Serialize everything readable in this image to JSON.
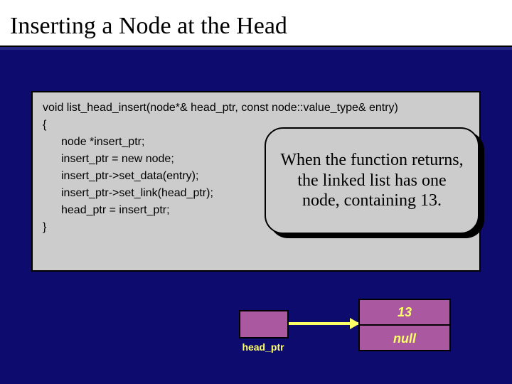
{
  "title": "Inserting a Node at the Head",
  "code": {
    "sig": "void list_head_insert(node*& head_ptr, const node::value_type& entry)",
    "open": "{",
    "l1": "node *insert_ptr;",
    "blank": "",
    "l2": "insert_ptr = new node;",
    "l3": "insert_ptr->set_data(entry);",
    "l4": "insert_ptr->set_link(head_ptr);",
    "l5": "head_ptr = insert_ptr;",
    "close": "}"
  },
  "callout": "When the function returns, the linked list has one node, containing 13.",
  "node": {
    "data": "13",
    "link": "null"
  },
  "pointer_label": "head_ptr"
}
